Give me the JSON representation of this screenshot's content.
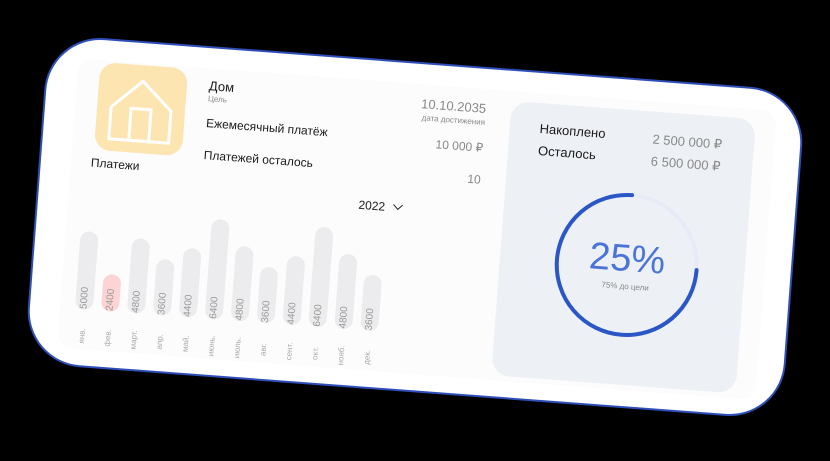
{
  "goal": {
    "title": "Дом",
    "subtitle": "Цель",
    "icon": "house-icon",
    "date": "10.10.2035",
    "date_caption": "дата достижения"
  },
  "monthly_payment": {
    "label": "Ежемесячный платёж",
    "value": "10 000 ₽"
  },
  "payments_left": {
    "label": "Платежей осталось",
    "value": "10"
  },
  "payments": {
    "title": "Платежи",
    "year": "2022",
    "months": [
      {
        "label": "янв.",
        "value": 5000,
        "text": "5000"
      },
      {
        "label": "фев.",
        "value": 2400,
        "text": "2400",
        "highlight": true
      },
      {
        "label": "март.",
        "value": 4800,
        "text": "4800"
      },
      {
        "label": "апр.",
        "value": 3600,
        "text": "3600"
      },
      {
        "label": "май.",
        "value": 4400,
        "text": "4400"
      },
      {
        "label": "июнь.",
        "value": 6400,
        "text": "6400"
      },
      {
        "label": "июль.",
        "value": 4800,
        "text": "4800"
      },
      {
        "label": "авг.",
        "value": 3600,
        "text": "3600"
      },
      {
        "label": "сент.",
        "value": 4400,
        "text": "4400"
      },
      {
        "label": "окт.",
        "value": 6400,
        "text": "6400"
      },
      {
        "label": "нояб.",
        "value": 4800,
        "text": "4800"
      },
      {
        "label": "дек.",
        "value": 3600,
        "text": "3600"
      }
    ]
  },
  "savings": {
    "saved_label": "Накоплено",
    "saved_value": "2 500 000 ₽",
    "left_label": "Осталось",
    "left_value": "6 500 000 ₽",
    "percent": "25%",
    "caption": "75% до цели",
    "ring_fill": 0.75,
    "ring_color": "#2a56c6",
    "ring_track": "#e8eaf6"
  }
}
